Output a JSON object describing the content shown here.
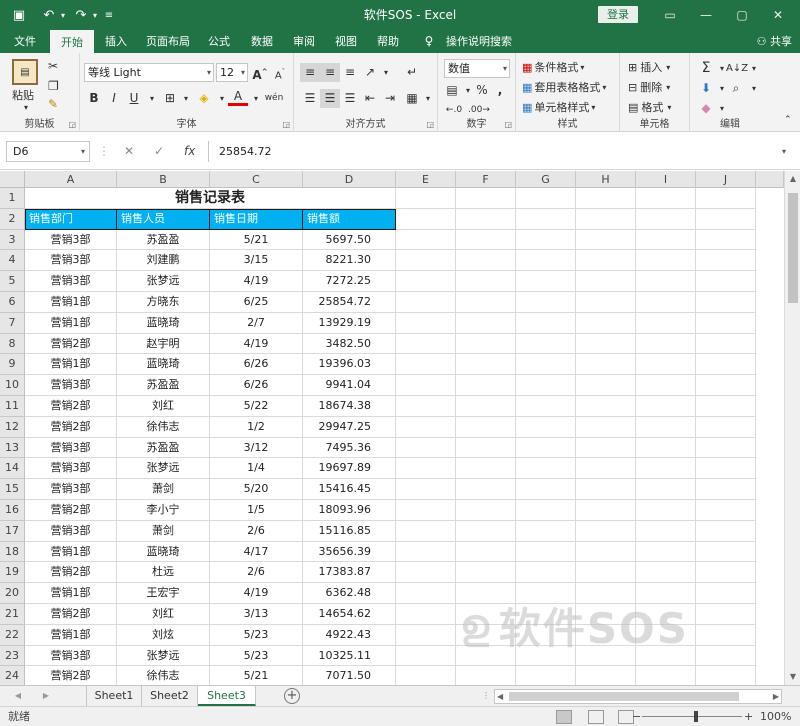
{
  "titlebar": {
    "title": "软件SOS  -  Excel",
    "login": "登录",
    "save_icon": "▣",
    "undo_icon": "↶",
    "redo_icon": "↷",
    "customize_icon": "≡",
    "min_icon": "—",
    "restore_icon": "▢",
    "close_icon": "✕",
    "ribbon_opts_icon": "▭"
  },
  "tabs": [
    {
      "label": "文件"
    },
    {
      "label": "开始"
    },
    {
      "label": "插入"
    },
    {
      "label": "页面布局"
    },
    {
      "label": "公式"
    },
    {
      "label": "数据"
    },
    {
      "label": "审阅"
    },
    {
      "label": "视图"
    },
    {
      "label": "帮助"
    },
    {
      "label": "操作说明搜索"
    }
  ],
  "share": "共享",
  "ribbon": {
    "clipboard": {
      "label": "剪贴板",
      "paste": "粘贴"
    },
    "font": {
      "label": "字体",
      "name": "等线 Light",
      "size": "12",
      "bold": "B",
      "italic": "I",
      "underline": "U",
      "grow": "A",
      "shrink": "A",
      "fontcolor": "A",
      "phonetic": "wén"
    },
    "alignment": {
      "label": "对齐方式"
    },
    "number": {
      "label": "数字",
      "format": "数值",
      "percent": "%",
      "comma": ","
    },
    "styles": {
      "label": "样式",
      "cond": "条件格式",
      "table": "套用表格格式",
      "cell": "单元格样式"
    },
    "cells": {
      "label": "单元格",
      "insert": "插入",
      "delete": "删除",
      "format": "格式"
    },
    "editing": {
      "label": "编辑"
    }
  },
  "formula_bar": {
    "namebox": "D6",
    "cancel": "✕",
    "enter": "✓",
    "fx": "fx",
    "value": "25854.72"
  },
  "columns": [
    "A",
    "B",
    "C",
    "D",
    "E",
    "F",
    "G",
    "H",
    "I",
    "J"
  ],
  "table": {
    "title": "销售记录表",
    "headers": [
      "销售部门",
      "销售人员",
      "销售日期",
      "销售额"
    ],
    "rows": [
      [
        "营销3部",
        "苏盈盈",
        "5/21",
        "5697.50"
      ],
      [
        "营销3部",
        "刘建鹏",
        "3/15",
        "8221.30"
      ],
      [
        "营销3部",
        "张梦远",
        "4/19",
        "7272.25"
      ],
      [
        "营销1部",
        "方晓东",
        "6/25",
        "25854.72"
      ],
      [
        "营销1部",
        "蓝晓琦",
        "2/7",
        "13929.19"
      ],
      [
        "营销2部",
        "赵宇明",
        "4/19",
        "3482.50"
      ],
      [
        "营销1部",
        "蓝晓琦",
        "6/26",
        "19396.03"
      ],
      [
        "营销3部",
        "苏盈盈",
        "6/26",
        "9941.04"
      ],
      [
        "营销2部",
        "刘红",
        "5/22",
        "18674.38"
      ],
      [
        "营销2部",
        "徐伟志",
        "1/2",
        "29947.25"
      ],
      [
        "营销3部",
        "苏盈盈",
        "3/12",
        "7495.36"
      ],
      [
        "营销3部",
        "张梦远",
        "1/4",
        "19697.89"
      ],
      [
        "营销3部",
        "萧剑",
        "5/20",
        "15416.45"
      ],
      [
        "营销2部",
        "李小宁",
        "1/5",
        "18093.96"
      ],
      [
        "营销3部",
        "萧剑",
        "2/6",
        "15116.85"
      ],
      [
        "营销1部",
        "蓝晓琦",
        "4/17",
        "35656.39"
      ],
      [
        "营销2部",
        "杜远",
        "2/6",
        "17383.87"
      ],
      [
        "营销1部",
        "王宏宇",
        "4/19",
        "6362.48"
      ],
      [
        "营销2部",
        "刘红",
        "3/13",
        "14654.62"
      ],
      [
        "营销1部",
        "刘炫",
        "5/23",
        "4922.43"
      ],
      [
        "营销3部",
        "张梦远",
        "5/23",
        "10325.11"
      ],
      [
        "营销2部",
        "徐伟志",
        "5/21",
        "7071.50"
      ]
    ]
  },
  "row_numbers": [
    "1",
    "2",
    "3",
    "4",
    "5",
    "6",
    "7",
    "8",
    "9",
    "10",
    "11",
    "12",
    "13",
    "14",
    "15",
    "16",
    "17",
    "18",
    "19",
    "20",
    "21",
    "22",
    "23",
    "24"
  ],
  "sheets": [
    "Sheet1",
    "Sheet2",
    "Sheet3"
  ],
  "active_sheet": "Sheet3",
  "watermark": "软件SOS",
  "status": {
    "ready": "就绪",
    "zoom": "100%",
    "zoom_out": "−",
    "zoom_in": "+"
  },
  "colors": {
    "accent": "#217346",
    "header_fill": "#00b0f0"
  }
}
